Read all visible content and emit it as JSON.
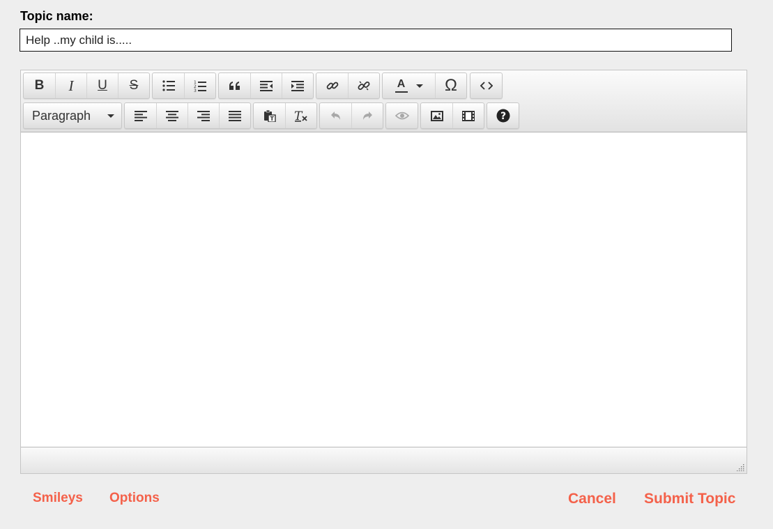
{
  "form": {
    "topic_label": "Topic name:",
    "topic_value": "Help ..my child is.....",
    "content_value": ""
  },
  "toolbar": {
    "row1": [
      [
        "bold",
        "italic",
        "underline",
        "strikethrough"
      ],
      [
        "bullet-list",
        "numbered-list"
      ],
      [
        "blockquote",
        "outdent",
        "indent"
      ],
      [
        "insert-link",
        "remove-link"
      ],
      [
        "text-color",
        "special-character"
      ],
      [
        "source-code"
      ]
    ],
    "row2": [
      [
        "format-select"
      ],
      [
        "align-left",
        "align-center",
        "align-right",
        "align-justify"
      ],
      [
        "paste-text",
        "clear-formatting"
      ],
      [
        "undo",
        "redo"
      ],
      [
        "preview"
      ],
      [
        "insert-image",
        "insert-media"
      ],
      [
        "help"
      ]
    ],
    "bold_letter": "B",
    "italic_letter": "I",
    "underline_letter": "U",
    "strike_letter": "S",
    "color_letter": "A",
    "omega": "Ω",
    "format_value": "Paragraph"
  },
  "footer": {
    "smileys": "Smileys",
    "options": "Options",
    "cancel": "Cancel",
    "submit": "Submit Topic"
  },
  "colors": {
    "accent": "#f4614a",
    "page_background": "#eeeeee"
  }
}
